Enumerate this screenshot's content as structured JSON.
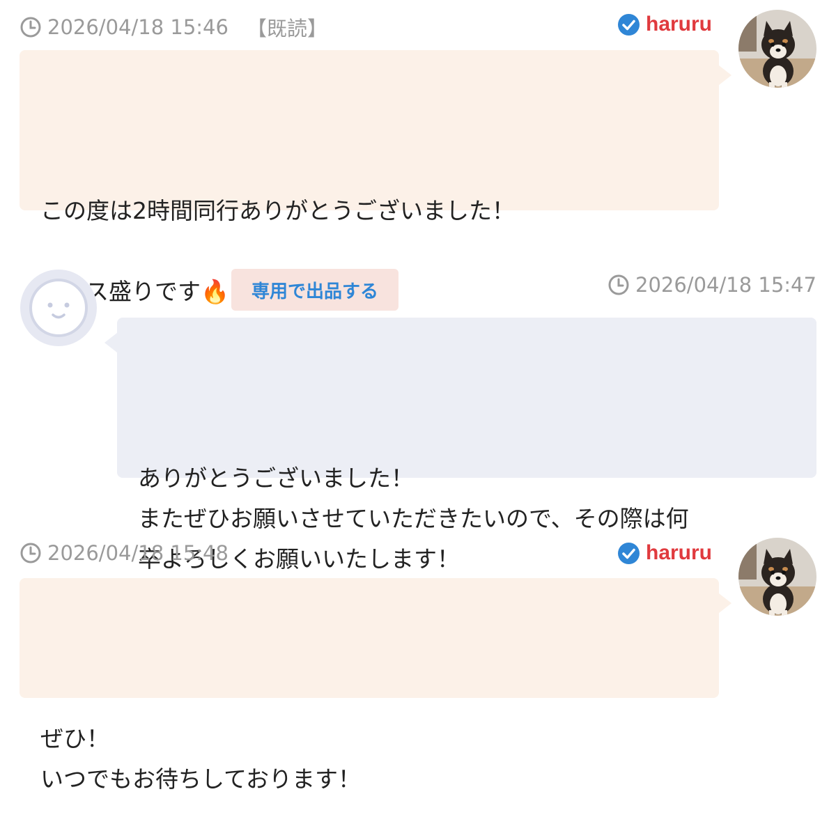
{
  "messages": [
    {
      "timestamp": "2026/04/18 15:46",
      "read_status": "【既読】",
      "username": "haruru",
      "text": "この度は2時間同行ありがとうございました！\n\nナイス盛りです🔥"
    },
    {
      "timestamp": "2026/04/18 15:47",
      "action_button_label": "専用で出品する",
      "text": "ありがとうございました！\nまたぜひお願いさせていただきたいので、その際は何\n卒よろしくお願いいたします！"
    },
    {
      "timestamp": "2026/04/18 15:48",
      "username": "haruru",
      "text": "ぜひ！\nいつでもお待ちしております！"
    }
  ],
  "colors": {
    "own_bubble": "#fcf1e8",
    "other_bubble": "#eceef5",
    "username": "#e03a3e",
    "verified_badge": "#2f86d6",
    "timestamp": "#9a9a9a",
    "action_button_bg": "#f8e3de",
    "action_button_text": "#2f86d6"
  },
  "icons": {
    "clock": "clock-icon",
    "verified": "verified-check-icon",
    "default_avatar": "smiley-face-icon",
    "user_avatar": "shiba-dog-photo"
  }
}
